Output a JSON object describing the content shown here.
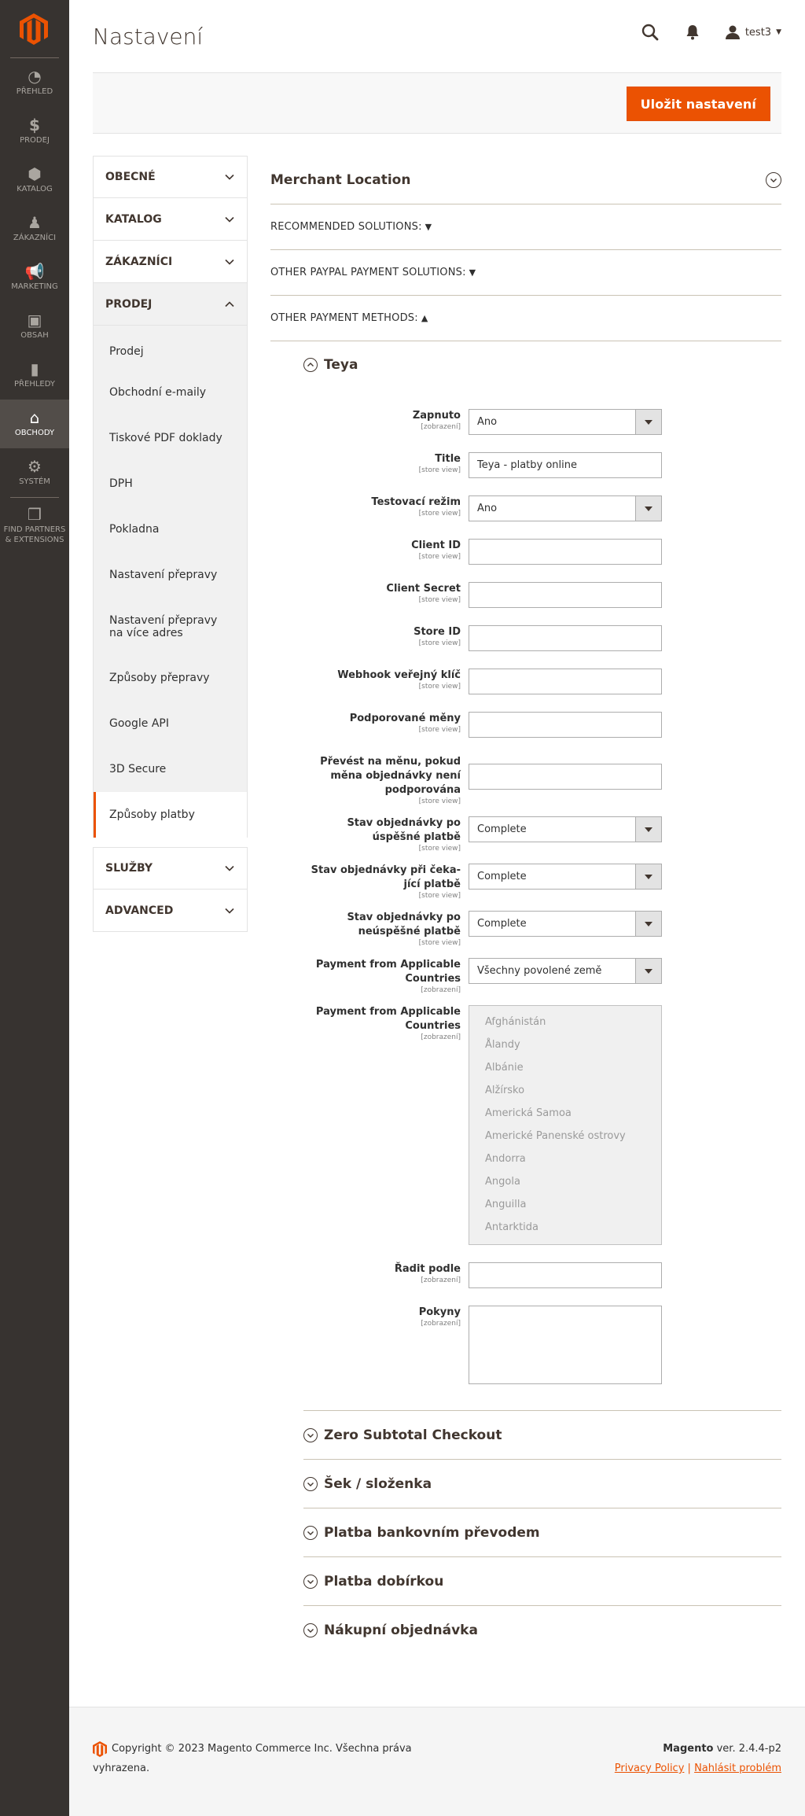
{
  "menu": [
    {
      "label": "PŘEHLED",
      "icon": "speedometer-icon"
    },
    {
      "label": "PRODEJ",
      "icon": "dollar-icon"
    },
    {
      "label": "KATALOG",
      "icon": "cube-icon"
    },
    {
      "label": "ZÁKAZNÍCI",
      "icon": "person-icon"
    },
    {
      "label": "MARKETING",
      "icon": "megaphone-icon"
    },
    {
      "label": "OBSAH",
      "icon": "layout-icon"
    },
    {
      "label": "PŘEHLEDY",
      "icon": "bar-chart-icon"
    },
    {
      "label": "OBCHODY",
      "icon": "store-icon"
    },
    {
      "label": "SYSTÉM",
      "icon": "gear-icon"
    },
    {
      "label": "FIND PARTNERS & EXTENSIONS",
      "icon": "boxes-icon"
    }
  ],
  "header": {
    "title": "Nastavení",
    "user": "test3"
  },
  "actions": {
    "save": "Uložit nastavení"
  },
  "tabs": {
    "obecne": "OBECNÉ",
    "katalog": "KATALOG",
    "zakaznici": "ZÁKAZNÍCI",
    "prodej": "PRODEJ",
    "prodej_items": [
      "Prodej",
      "Obchodní e-maily",
      "Tiskové PDF doklady",
      "DPH",
      "Pokladna",
      "Nastavení přepravy",
      "Nastavení přepravy na více adres",
      "Způsoby přepravy",
      "Google API",
      "3D Secure",
      "Způsoby platby"
    ],
    "sluzby": "SLUŽBY",
    "advanced": "ADVANCED"
  },
  "sections": {
    "merchant": "Merchant Location",
    "recommended": "RECOMMENDED SOLUTIONS:",
    "other_paypal": "OTHER PAYPAL PAYMENT SOLUTIONS:",
    "other_methods": "OTHER PAYMENT METHODS:",
    "tri_down": "▼",
    "tri_up": "▲"
  },
  "teya": {
    "title": "Teya",
    "fields": {
      "enabled": {
        "label": "Zapnuto",
        "scope": "[zobrazení]",
        "value": "Ano"
      },
      "title": {
        "label": "Title",
        "scope": "[store view]",
        "value": "Teya - platby online"
      },
      "test_mode": {
        "label": "Testovací režim",
        "scope": "[store view]",
        "value": "Ano"
      },
      "client_id": {
        "label": "Client ID",
        "scope": "[store view]",
        "value": ""
      },
      "client_secret": {
        "label": "Client Secret",
        "scope": "[store view]",
        "value": ""
      },
      "store_id": {
        "label": "Store ID",
        "scope": "[store view]",
        "value": ""
      },
      "webhook": {
        "label": "Webhook veřejný klíč",
        "scope": "[store view]",
        "value": ""
      },
      "currencies": {
        "label": "Podporované měny",
        "scope": "[store view]",
        "value": ""
      },
      "convert": {
        "label": "Převést na měnu, pokud měna objednávky není podporována",
        "scope": "[store view]",
        "value": ""
      },
      "success_status": {
        "label": "Stav objednávky po úspěšné platbě",
        "scope": "[store view]",
        "value": "Complete"
      },
      "pending_status": {
        "label": "Stav objednávky při čeka-jící platbě",
        "scope": "[store view]",
        "value": "Complete"
      },
      "failed_status": {
        "label": "Stav objednávky po neúspěšné platbě",
        "scope": "[store view]",
        "value": "Complete"
      },
      "allowspecific": {
        "label": "Payment from Applicable Countries",
        "scope": "[zobrazení]",
        "value": "Všechny povolené země"
      },
      "specificcountry": {
        "label": "Payment from Applicable Countries",
        "scope": "[zobrazení]",
        "options": [
          "Afghánistán",
          "Ålandy",
          "Albánie",
          "Alžírsko",
          "Americká Samoa",
          "Americké Panenské ostrovy",
          "Andorra",
          "Angola",
          "Anguilla",
          "Antarktida"
        ]
      },
      "sort_order": {
        "label": "Řadit podle",
        "scope": "[zobrazení]",
        "value": ""
      },
      "instructions": {
        "label": "Pokyny",
        "scope": "[zobrazení]",
        "value": ""
      }
    }
  },
  "other_methods": [
    "Zero Subtotal Checkout",
    "Šek / složenka",
    "Platba bankovním převodem",
    "Platba dobírkou",
    "Nákupní objednávka"
  ],
  "footer": {
    "copyright": "Copyright © 2023 Magento Commerce Inc. Všechna práva vyhrazena.",
    "brand": "Magento",
    "version": " ver. 2.4.4-p2",
    "privacy": "Privacy Policy",
    "separator": "|",
    "report": "Nahlásit problém"
  },
  "colors": {
    "accent": "#eb5202",
    "menu_bg": "#373330"
  }
}
